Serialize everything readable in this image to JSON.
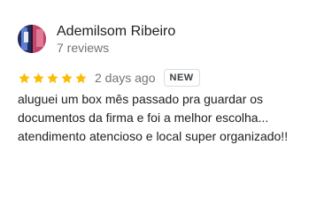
{
  "review": {
    "author": "Ademilsom Ribeiro",
    "review_count": "7 reviews",
    "rating": 5,
    "rating_max": 5,
    "date": "2 days ago",
    "badge": "NEW",
    "text": "aluguei um box mês passado pra guardar os documentos da firma e foi a melhor escolha... atendimento atencioso e local super organizado!!"
  },
  "colors": {
    "star": "#fbbc04",
    "name": "#202124",
    "secondary": "#70757a",
    "badge_border": "#dadce0"
  }
}
